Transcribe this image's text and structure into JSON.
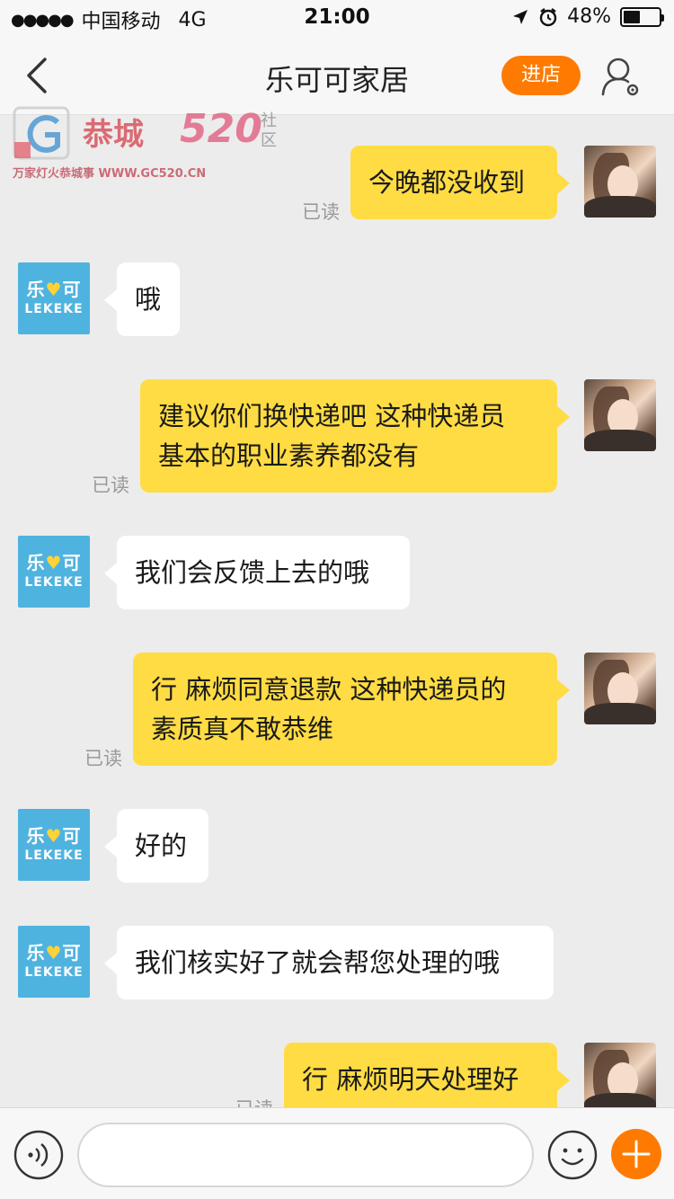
{
  "status_bar": {
    "signal_dots": "●●●●●",
    "carrier": "中国移动",
    "network": "4G",
    "time": "21:00",
    "battery_text": "48%",
    "battery_level": 0.48
  },
  "nav": {
    "title": "乐可可家居",
    "shop_button": "进店"
  },
  "watermark": {
    "main": "恭城",
    "number": "520",
    "side": "社区",
    "sub": "万家灯火恭城事 WWW.GC520.CN"
  },
  "shop_avatar": {
    "brand_cn_left": "乐",
    "brand_heart": "♥",
    "brand_cn_right": "可",
    "brand_en": "LEKEKE"
  },
  "messages": [
    {
      "sender": "me",
      "lines": [
        "今晚都没收到"
      ],
      "read": "已读"
    },
    {
      "sender": "shop",
      "lines": [
        "哦"
      ]
    },
    {
      "sender": "me",
      "lines": [
        "建议你们换快递吧 这种快递员",
        "基本的职业素养都没有"
      ],
      "read": "已读"
    },
    {
      "sender": "shop",
      "lines": [
        "我们会反馈上去的哦"
      ]
    },
    {
      "sender": "me",
      "lines": [
        "行 麻烦同意退款 这种快递员的",
        "素质真不敢恭维"
      ],
      "read": "已读"
    },
    {
      "sender": "shop",
      "lines": [
        "好的"
      ]
    },
    {
      "sender": "shop",
      "lines": [
        "我们核实好了就会帮您处理的哦"
      ]
    },
    {
      "sender": "me",
      "lines": [
        "行 麻烦明天处理好"
      ],
      "read": "已读"
    }
  ],
  "input": {
    "value": "",
    "placeholder": ""
  },
  "colors": {
    "accent_orange": "#ff7a00",
    "my_bubble": "#ffdc43",
    "shop_avatar_bg": "#4fb3e0",
    "background": "#ececec"
  },
  "icons": {
    "back": "chevron-left-icon",
    "user": "user-settings-icon",
    "voice": "voice-icon",
    "emoji": "emoji-icon",
    "plus": "plus-icon",
    "location": "location-arrow-icon",
    "alarm": "alarm-icon",
    "battery": "battery-icon"
  }
}
